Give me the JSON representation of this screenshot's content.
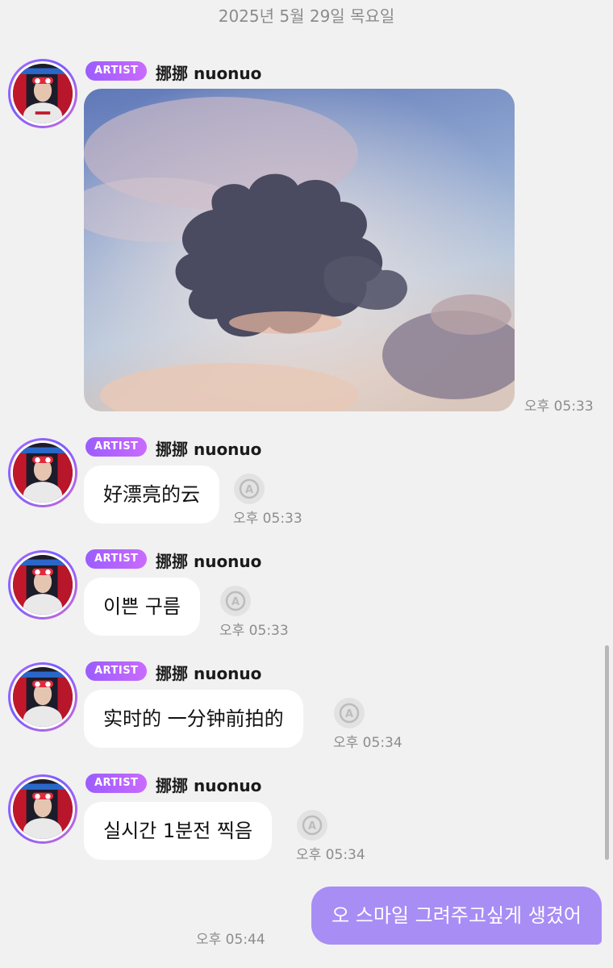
{
  "date_header": "2025년 5월 29일 목요일",
  "sender": {
    "badge": "ARTIST",
    "name": "挪挪 nuonuo"
  },
  "messages": [
    {
      "type": "image",
      "time": "오후 05:33"
    },
    {
      "type": "text",
      "text": "好漂亮的云",
      "time": "오후 05:33"
    },
    {
      "type": "text",
      "text": "이쁜 구름",
      "time": "오후 05:33"
    },
    {
      "type": "text",
      "text": "实时的 一分钟前拍的",
      "time": "오후 05:34"
    },
    {
      "type": "text",
      "text": "실시간 1분전 찍음",
      "time": "오후 05:34"
    }
  ],
  "my_message": {
    "text": "오 스마일 그려주고싶게 생겼어",
    "time": "오후 05:44"
  },
  "icons": {
    "translate": "translate-icon",
    "avatar": "artist-avatar"
  },
  "colors": {
    "accent": "#a88df5",
    "badge": "#9b5cff",
    "background": "#f1f1f1"
  }
}
